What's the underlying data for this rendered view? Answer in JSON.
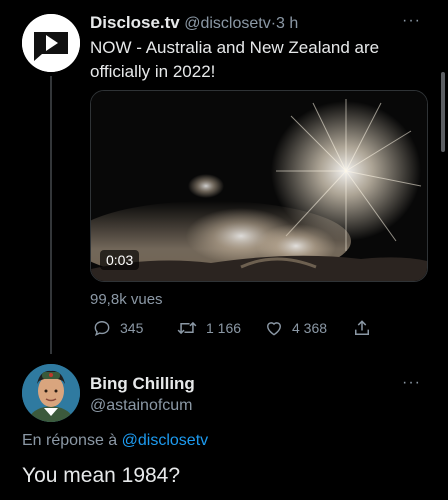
{
  "tweet": {
    "author_name": "Disclose.tv",
    "handle": "@disclosetv",
    "separator": "·",
    "time": "3 h",
    "text": "NOW - Australia and New Zealand are officially in 2022!",
    "media": {
      "duration": "0:03"
    },
    "views": "99,8k vues",
    "actions": {
      "replies": "345",
      "retweets": "1 166",
      "likes": "4 368"
    },
    "more": "···"
  },
  "reply": {
    "author_name": "Bing Chilling",
    "handle": "@astainofcum",
    "reply_prefix": "En réponse à",
    "reply_target": "@disclosetv",
    "text": "You mean 1984?",
    "more": "···"
  },
  "icons": {
    "reply": "comment-icon",
    "retweet": "retweet-icon",
    "like": "heart-icon",
    "share": "share-icon"
  },
  "colors": {
    "background": "#000000",
    "text": "#e7e9ea",
    "muted": "#8b98a5",
    "link": "#1d9bf0"
  }
}
